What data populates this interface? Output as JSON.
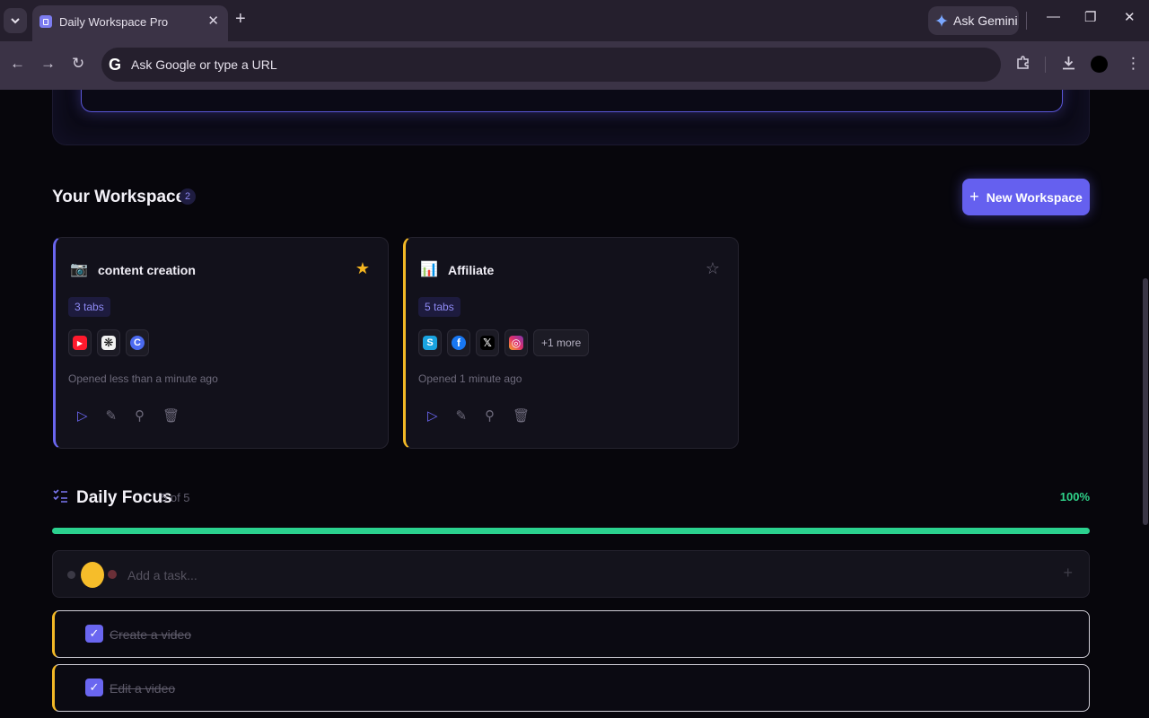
{
  "browser": {
    "tab_title": "Daily Workspace Pro",
    "tab_close": "✕",
    "new_tab": "+",
    "gemini_label": "Ask Gemini",
    "omnibox_placeholder": "Ask Google or type a URL",
    "omnibox_g": "G",
    "win_minimize": "—",
    "win_restore": "❐",
    "win_close": "✕"
  },
  "workspaces": {
    "title": "Your Workspaces",
    "count": "2",
    "new_button": "New Workspace",
    "new_plus": "+",
    "cards": [
      {
        "emoji": "📷",
        "name": "content creation",
        "starred": true,
        "star": "★",
        "tabs_badge": "3 tabs",
        "opened": "Opened less than a minute ago",
        "accent": "#6a66f0",
        "apps": [
          {
            "icon": "youtube-icon",
            "glyph": "▶",
            "color": "#ff1a2d"
          },
          {
            "icon": "chatgpt-icon",
            "glyph": "❋",
            "color": "#1c1c1c"
          },
          {
            "icon": "canva-icon",
            "glyph": "C",
            "color": "#4b6af0"
          }
        ]
      },
      {
        "emoji": "📊",
        "name": "Affiliate",
        "starred": false,
        "star": "☆",
        "tabs_badge": "5 tabs",
        "opened": "Opened 1 minute ago",
        "accent": "#f2b826",
        "apps": [
          {
            "icon": "systeme-icon",
            "glyph": "S",
            "color": "#19a3e0"
          },
          {
            "icon": "facebook-icon",
            "glyph": "f",
            "color": "#1877f2"
          },
          {
            "icon": "x-icon",
            "glyph": "𝕏",
            "color": "#000000"
          },
          {
            "icon": "instagram-icon",
            "glyph": "◎",
            "color": "#d62b7a"
          }
        ],
        "more": "+1 more"
      }
    ],
    "actions": {
      "play": "▷",
      "edit": "✎",
      "pin": "⚲",
      "delete": "🗑"
    }
  },
  "focus": {
    "title": "Daily Focus",
    "count": "5 of 5",
    "percent": "100%",
    "progress": 1.0,
    "progress_color": "#2bd18f",
    "add_placeholder": "Add a task...",
    "add_plus": "+",
    "check": "✓",
    "tasks": [
      {
        "text": "Create a video",
        "done": true
      },
      {
        "text": "Edit a video",
        "done": true
      }
    ]
  }
}
